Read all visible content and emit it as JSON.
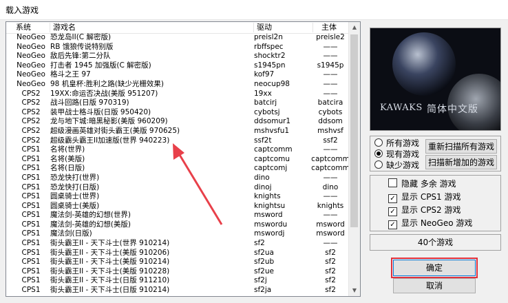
{
  "window": {
    "title": "载入游戏"
  },
  "columns": {
    "system": "系统",
    "name": "游戏名",
    "driver": "驱动",
    "parent": "主体"
  },
  "rows": [
    {
      "system": "NeoGeo",
      "name": "恐龙岛II(C 解密版)",
      "driver": "preisl2n",
      "parent": "preisle2"
    },
    {
      "system": "NeoGeo",
      "name": "RB 饿狼传说特别版",
      "driver": "rbffspec",
      "parent": "——"
    },
    {
      "system": "NeoGeo",
      "name": "敌后先锋:第二分队",
      "driver": "shocktr2",
      "parent": "——"
    },
    {
      "system": "NeoGeo",
      "name": "打击者 1945 加强版(C 解密版)",
      "driver": "s1945pn",
      "parent": "s1945p"
    },
    {
      "system": "NeoGeo",
      "name": "格斗之王 97",
      "driver": "kof97",
      "parent": "——"
    },
    {
      "system": "NeoGeo",
      "name": "98 机皇杯:胜利之路(缺少光栅效果)",
      "driver": "neocup98",
      "parent": "——"
    },
    {
      "system": "CPS2",
      "name": "19XX:命运否决战(美版 951207)",
      "driver": "19xx",
      "parent": "——"
    },
    {
      "system": "CPS2",
      "name": "战斗回路(日版 970319)",
      "driver": "batcirj",
      "parent": "batcira"
    },
    {
      "system": "CPS2",
      "name": "装甲战士格斗版(日版 950420)",
      "driver": "cybotsj",
      "parent": "cybots"
    },
    {
      "system": "CPS2",
      "name": "龙与地下城:暗黑秘影(美版 960209)",
      "driver": "ddsomur1",
      "parent": "ddsom"
    },
    {
      "system": "CPS2",
      "name": "超级漫画英雄对街头霸王(美版 970625)",
      "driver": "mshvsfu1",
      "parent": "mshvsf"
    },
    {
      "system": "CPS2",
      "name": "超级霸头霸王II加速版(世界 940223)",
      "driver": "ssf2t",
      "parent": "ssf2"
    },
    {
      "system": "CPS1",
      "name": "名将(世界)",
      "driver": "captcomm",
      "parent": "——"
    },
    {
      "system": "CPS1",
      "name": "名将(美版)",
      "driver": "captcomu",
      "parent": "captcomm"
    },
    {
      "system": "CPS1",
      "name": "名将(日版)",
      "driver": "captcomj",
      "parent": "captcomm"
    },
    {
      "system": "CPS1",
      "name": "恐龙快打(世界)",
      "driver": "dino",
      "parent": "——"
    },
    {
      "system": "CPS1",
      "name": "恐龙快打(日版)",
      "driver": "dinoj",
      "parent": "dino"
    },
    {
      "system": "CPS1",
      "name": "圆桌骑士(世界)",
      "driver": "knights",
      "parent": "——"
    },
    {
      "system": "CPS1",
      "name": "圆桌骑士(美版)",
      "driver": "knightsu",
      "parent": "knights"
    },
    {
      "system": "CPS1",
      "name": "魔法剑-英雄的幻想(世界)",
      "driver": "msword",
      "parent": "——"
    },
    {
      "system": "CPS1",
      "name": "魔法剑-英雄的幻想(美版)",
      "driver": "mswordu",
      "parent": "msword"
    },
    {
      "system": "CPS1",
      "name": "魔法剑(日版)",
      "driver": "mswordj",
      "parent": "msword"
    },
    {
      "system": "CPS1",
      "name": "街头霸王II - 天下斗士(世界 910214)",
      "driver": "sf2",
      "parent": "——"
    },
    {
      "system": "CPS1",
      "name": "街头霸王II - 天下斗士(美版 910206)",
      "driver": "sf2ua",
      "parent": "sf2"
    },
    {
      "system": "CPS1",
      "name": "街头霸王II - 天下斗士(美版 910214)",
      "driver": "sf2ub",
      "parent": "sf2"
    },
    {
      "system": "CPS1",
      "name": "街头霸王II - 天下斗士(美版 910228)",
      "driver": "sf2ue",
      "parent": "sf2"
    },
    {
      "system": "CPS1",
      "name": "街头霸王II - 天下斗士(日版 911210)",
      "driver": "sf2j",
      "parent": "sf2"
    },
    {
      "system": "CPS1",
      "name": "街头霸王II - 天下斗士(日版 910214)",
      "driver": "sf2ja",
      "parent": "sf2"
    }
  ],
  "logo": {
    "brand": "KAWAKS",
    "subtitle": "简体中文版"
  },
  "filter": {
    "all": "所有游戏",
    "existing": "现有游戏",
    "missing": "缺少游戏",
    "selected": "existing"
  },
  "buttons": {
    "rescan_all": "重新扫描所有游戏",
    "scan_new": "扫描新增加的游戏",
    "ok": "确定",
    "cancel": "取消"
  },
  "options": [
    {
      "label": "隐藏 多余 游戏",
      "checked": false
    },
    {
      "label": "显示 CPS1 游戏",
      "checked": true
    },
    {
      "label": "显示 CPS2 游戏",
      "checked": true
    },
    {
      "label": "显示 NeoGeo 游戏",
      "checked": true
    }
  ],
  "status": {
    "count": "40个游戏"
  }
}
